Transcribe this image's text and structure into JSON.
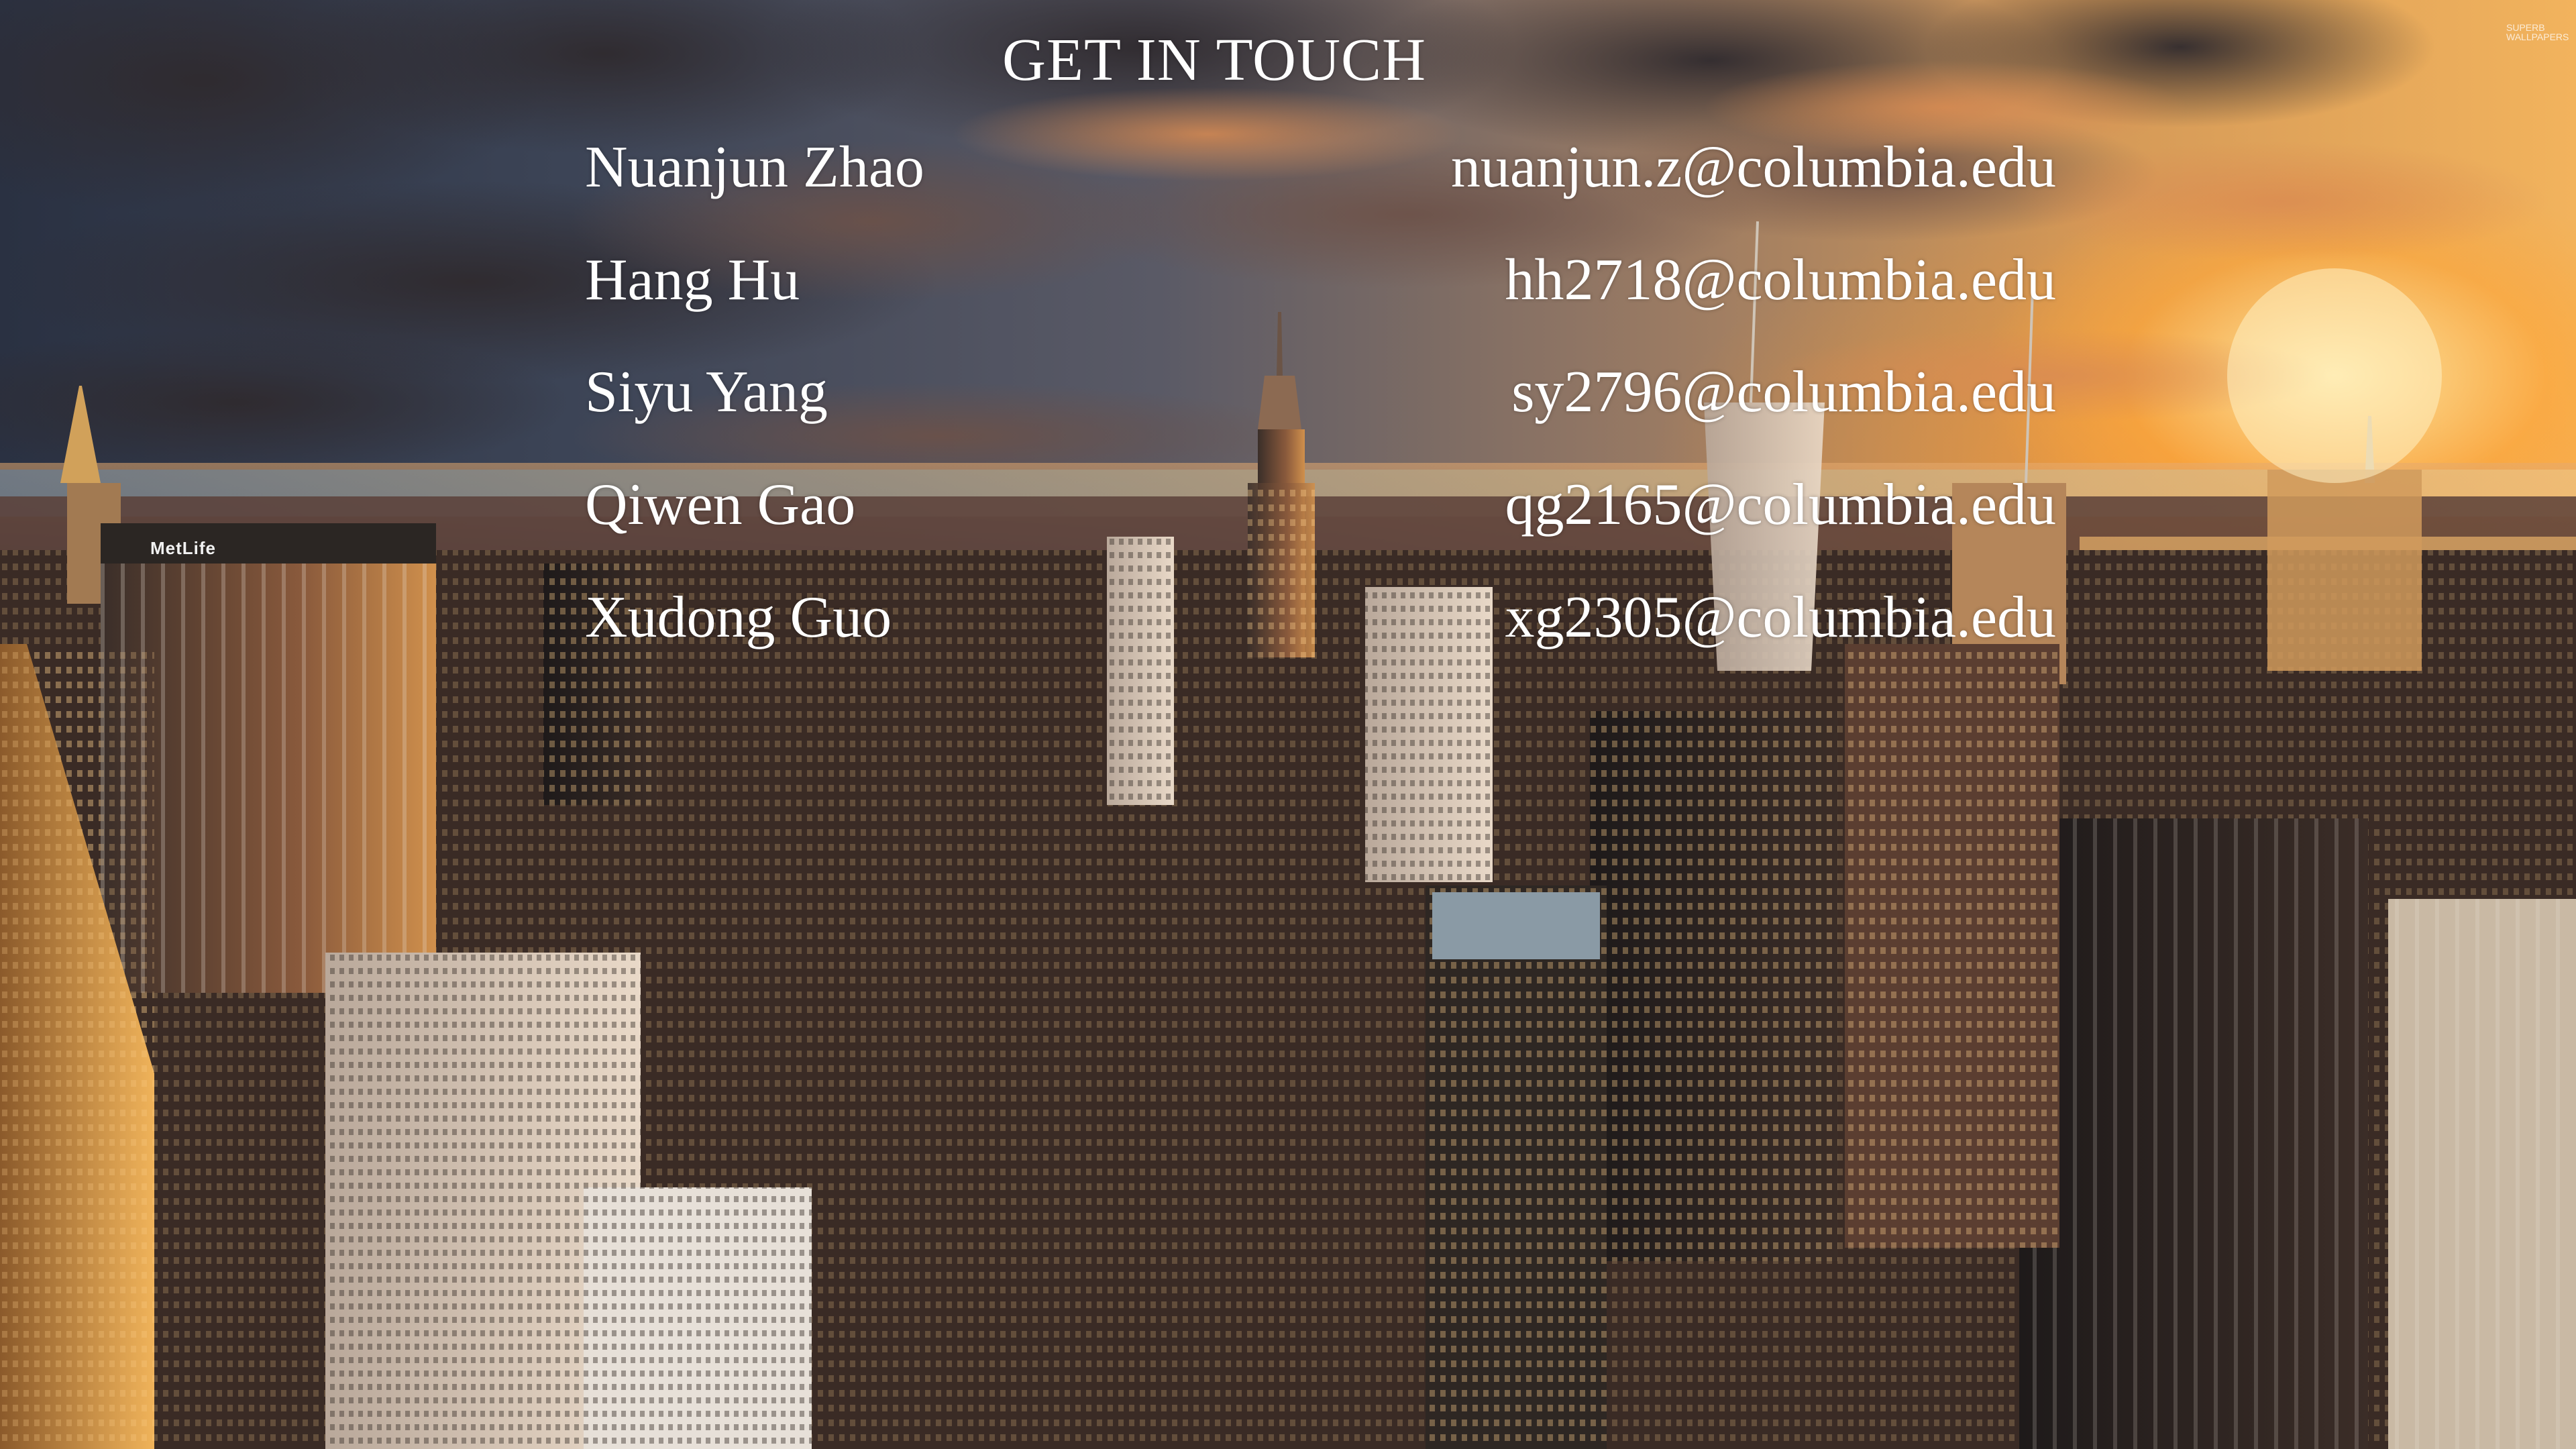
{
  "slide": {
    "title": "GET IN TOUCH",
    "contacts": [
      {
        "name": "Nuanjun Zhao",
        "email": "nuanjun.z@columbia.edu"
      },
      {
        "name": "Hang Hu",
        "email": "hh2718@columbia.edu"
      },
      {
        "name": "Siyu Yang",
        "email": "sy2796@columbia.edu"
      },
      {
        "name": "Qiwen Gao",
        "email": "qg2165@columbia.edu"
      },
      {
        "name": "Xudong Guo",
        "email": "xg2305@columbia.edu"
      }
    ]
  },
  "background": {
    "building_sign": "MetLife",
    "watermark": "SUPERB WALLPAPERS"
  },
  "colors": {
    "text": "#ffffff",
    "sunset_glow": "#f2b35d",
    "sky_dark": "#2a3142",
    "building_dark": "#2a2421",
    "building_warm": "#8a5a3c"
  }
}
